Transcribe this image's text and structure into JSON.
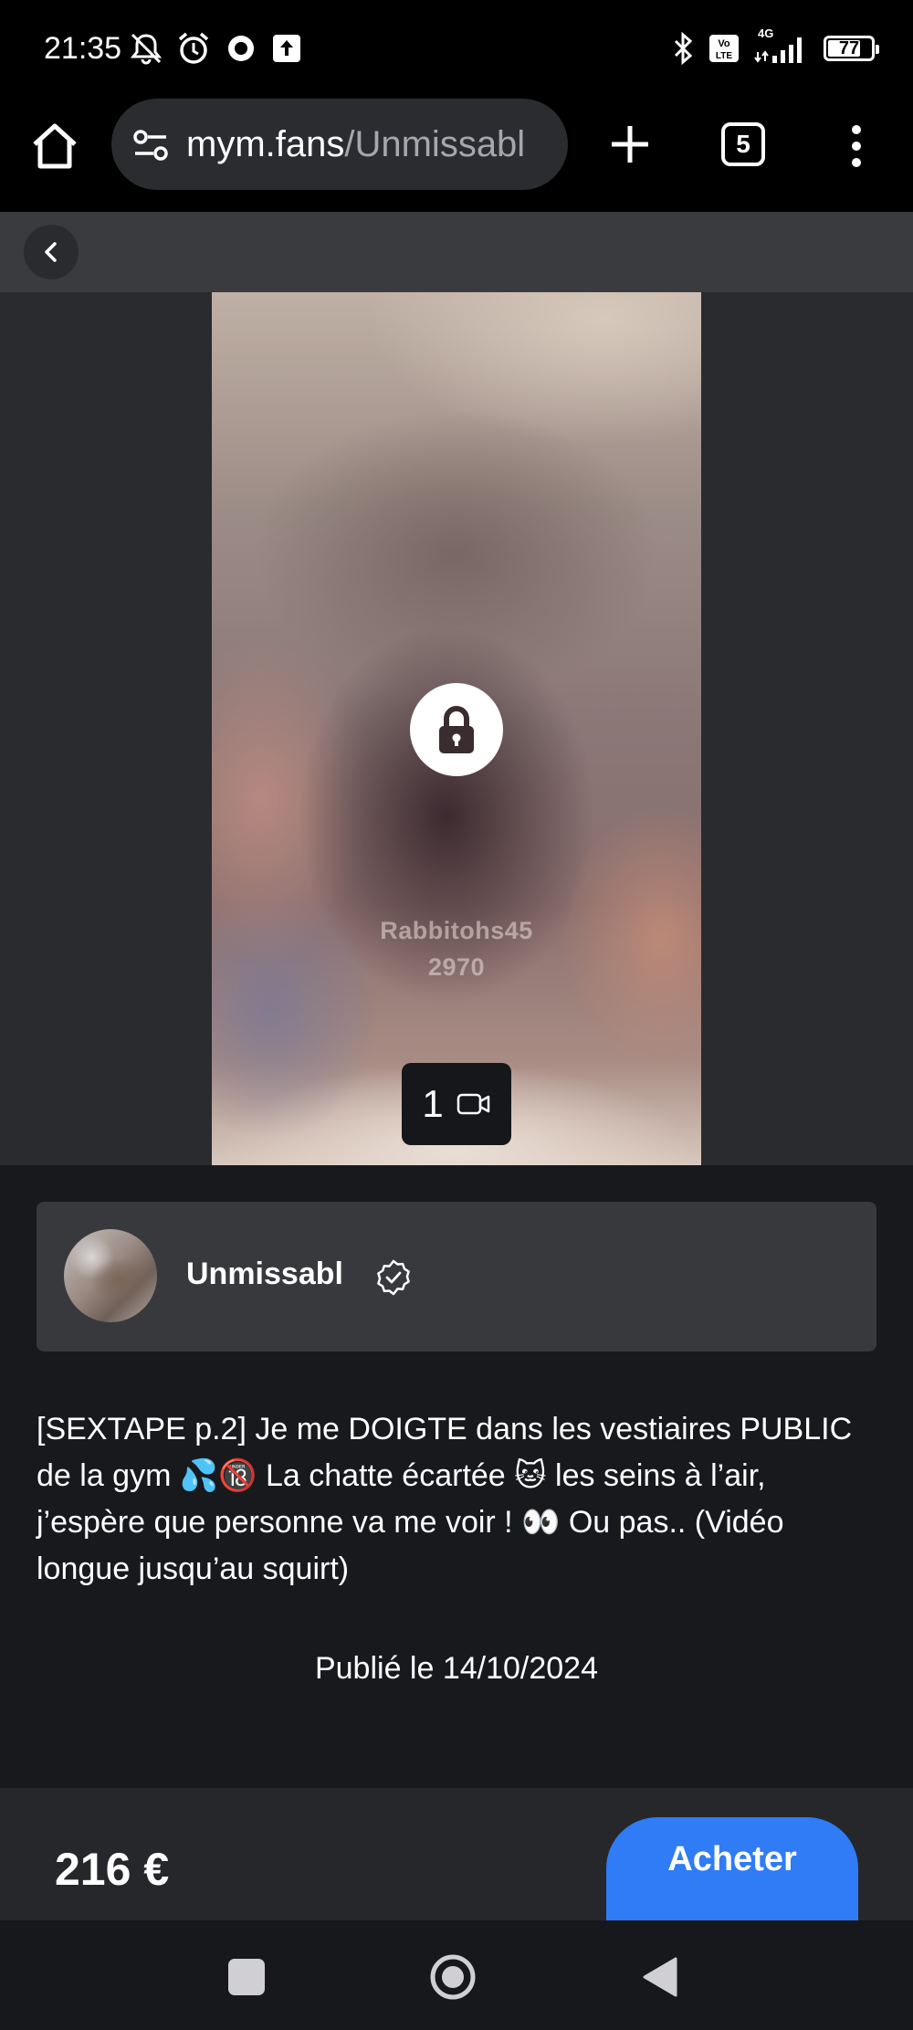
{
  "status_bar": {
    "time": "21:35",
    "network": "4G",
    "battery": "77",
    "battery_level": 0.77,
    "icons_left": [
      "mute-icon",
      "alarm-icon",
      "circle-app-icon",
      "upload-icon"
    ],
    "icons_right": [
      "bluetooth-icon",
      "volte-icon",
      "signal-icon",
      "battery-icon"
    ]
  },
  "browser": {
    "url_domain": "mym.fans",
    "url_path": "/Unmissabl",
    "tab_count": "5"
  },
  "media": {
    "watermark_line1": "Rabbitohs45",
    "watermark_line2": "2970",
    "media_count": "1",
    "lock_icon": "lock-icon",
    "media_type_icon": "video-camera-icon"
  },
  "creator": {
    "name": "Unmissabl",
    "verified": true
  },
  "post": {
    "description": "[SEXTAPE p.2] Je me DOIGTE dans les vestiaires PUBLIC de la gym 💦🔞 La chatte écartée 🐱 les seins à l’air, j’espère que personne va me voir ! 👀 Ou pas.. (Vidéo longue jusqu’au squirt)",
    "published": "Publié le 14/10/2024"
  },
  "purchase": {
    "price": "216 €",
    "buy_label": "Acheter"
  },
  "colors": {
    "accent": "#2f7cf6",
    "background": "#18191d",
    "card": "#38393d"
  }
}
